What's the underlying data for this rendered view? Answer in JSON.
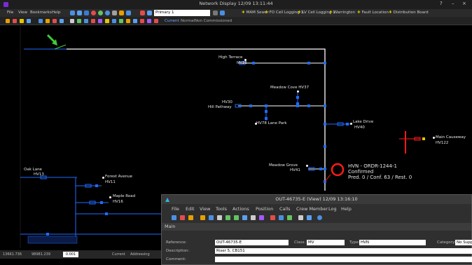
{
  "window": {
    "title": "Network Display  12/09 13:11:44",
    "help": "?",
    "minimize": "–",
    "close": "×"
  },
  "menu": {
    "items": [
      "File",
      "View",
      "Bookmarks",
      "Help"
    ],
    "combo_value": "Primary 1",
    "tags": [
      "MAM Sewer",
      "FO Cell Logging 1",
      "LV Cell Logging 1",
      "Warrington",
      "Fault Location",
      "Distribution Board"
    ]
  },
  "toolbar2": {
    "current": "Current",
    "normal": "Normal",
    "non_commissioned": "Non Commissioned"
  },
  "map": {
    "labels": {
      "high_terrace": "High Terrace",
      "hv36": "HV36",
      "meadow_cove": "Meadow Cove HV37",
      "hv30": "HV30",
      "hill_pathway": "Hill Pathway",
      "hv78_lane_park": "HV78 Lane Park",
      "lake_drive": "Lake Drive",
      "hv40": "HV40",
      "main_causeway": "Main Causeway",
      "hv122": "HV122",
      "oak_lane": "Oak Lane",
      "hv13": "HV13",
      "forest_avenue": "Forest Avenue",
      "hv11": "HV11",
      "maple_road": "Maple Road",
      "hv16": "HV16",
      "meadow_grove": "Meadow Grove",
      "hv41": "HV41"
    },
    "incident": {
      "line1": "HVN - ORDR-1244-1",
      "line2": "Confirmed",
      "line3": "Pred. 0 / Conf. 63 / Rest. 0"
    }
  },
  "statusbar": {
    "x": "13661.736",
    "y": "98981.239",
    "zoom": "0.001",
    "current": "Current",
    "addressing": "Addressing"
  },
  "dialog": {
    "title": "OUT-46735-E (View)  12/09 13:16:10",
    "menu": [
      "File",
      "Edit",
      "View",
      "Tools",
      "Actions",
      "Position",
      "Calls",
      "Crew Member",
      "Log",
      "Help"
    ],
    "section": "Main",
    "reference_label": "Reference:",
    "reference_value": "OUT-46735-E",
    "class_label": "Class:",
    "class_value": "MV",
    "type_label": "Type:",
    "type_value": "HVN",
    "category_label": "Category:",
    "category_value": "No Supply",
    "description_label": "Description:",
    "description_value": "Riser 5, CB151",
    "comment_label": "Comment:",
    "comment_value": ""
  },
  "colors": {
    "accent_blue": "#1f6bff",
    "red_incident": "#ff1a1a",
    "green_arrow": "#3ecb3a",
    "network_white": "#ffffff"
  }
}
